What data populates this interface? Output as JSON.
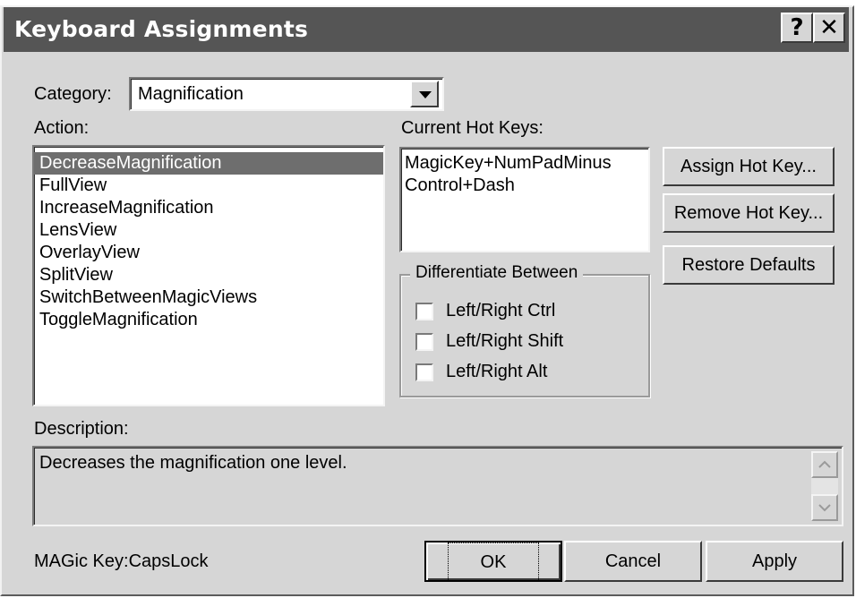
{
  "window": {
    "title": "Keyboard Assignments",
    "help_glyph": "?",
    "close_glyph": "✕"
  },
  "category": {
    "label": "Category:",
    "value": "Magnification"
  },
  "actions": {
    "label": "Action:",
    "items": [
      "DecreaseMagnification",
      "FullView",
      "IncreaseMagnification",
      "LensView",
      "OverlayView",
      "SplitView",
      "SwitchBetweenMagicViews",
      "ToggleMagnification"
    ],
    "selected_index": 0
  },
  "hotkeys": {
    "label": "Current Hot Keys:",
    "items": [
      "MagicKey+NumPadMinus",
      "Control+Dash"
    ]
  },
  "buttons": {
    "assign": "Assign Hot Key...",
    "remove": "Remove Hot Key...",
    "restore": "Restore Defaults",
    "ok": "OK",
    "cancel": "Cancel",
    "apply": "Apply"
  },
  "differentiate": {
    "title": "Differentiate Between",
    "options": [
      {
        "label": "Left/Right Ctrl",
        "checked": false
      },
      {
        "label": "Left/Right Shift",
        "checked": false
      },
      {
        "label": "Left/Right Alt",
        "checked": false
      }
    ]
  },
  "description": {
    "label": "Description:",
    "text": "Decreases the magnification one level."
  },
  "status": {
    "magic_key": "MAGic Key:CapsLock"
  },
  "icons": {
    "dropdown": "chevron-down-icon",
    "scroll_up": "scroll-up-icon",
    "scroll_down": "scroll-down-icon"
  }
}
